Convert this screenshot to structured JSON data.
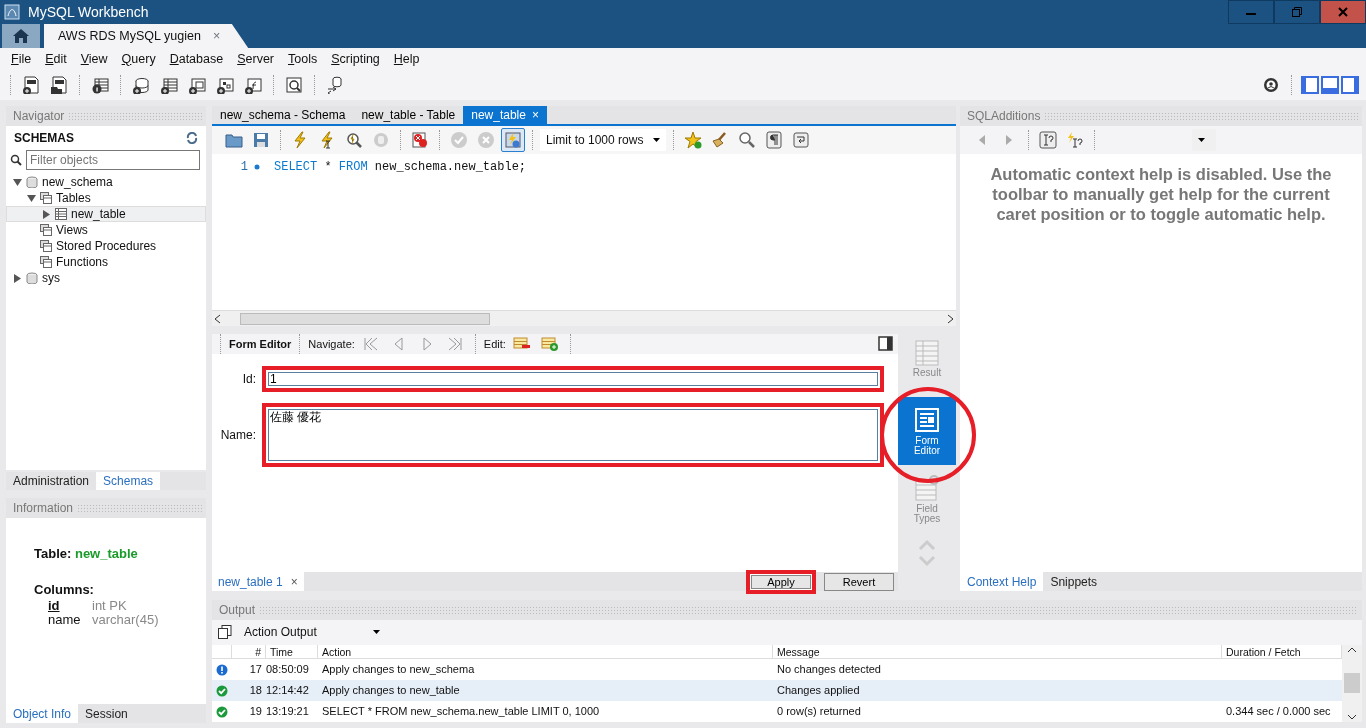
{
  "window": {
    "title": "MySQL Workbench"
  },
  "connection_tabs": [
    {
      "label": "AWS RDS MySQL yugien",
      "selected": true,
      "close": "×"
    }
  ],
  "menu": [
    "File",
    "Edit",
    "View",
    "Query",
    "Database",
    "Server",
    "Tools",
    "Scripting",
    "Help"
  ],
  "navigator": {
    "title": "Navigator",
    "section": "SCHEMAS",
    "filter": {
      "placeholder": "Filter objects"
    },
    "tree": [
      {
        "label": "new_schema",
        "kind": "schema",
        "expanded": true,
        "selected": false,
        "children": [
          {
            "label": "Tables",
            "kind": "folder",
            "expanded": true,
            "selected": false,
            "children": [
              {
                "label": "new_table",
                "kind": "table",
                "expanded": false,
                "selected": true
              }
            ]
          },
          {
            "label": "Views",
            "kind": "folder",
            "selected": false
          },
          {
            "label": "Stored Procedures",
            "kind": "folder",
            "selected": false
          },
          {
            "label": "Functions",
            "kind": "folder",
            "selected": false
          }
        ]
      },
      {
        "label": "sys",
        "kind": "schema",
        "expanded": false,
        "selected": false
      }
    ],
    "tabs": [
      {
        "label": "Administration",
        "selected": false
      },
      {
        "label": "Schemas",
        "selected": true
      }
    ]
  },
  "information": {
    "title": "Information",
    "table_label": "Table:",
    "table_name": "new_table",
    "columns_label": "Columns:",
    "columns": [
      {
        "name": "id",
        "type": "int PK",
        "primary": true
      },
      {
        "name": "name",
        "type": "varchar(45)",
        "primary": false
      }
    ],
    "tabs": [
      {
        "label": "Object Info",
        "selected": true
      },
      {
        "label": "Session",
        "selected": false
      }
    ]
  },
  "editor_tabs": [
    {
      "label": "new_schema - Schema",
      "selected": false
    },
    {
      "label": "new_table - Table",
      "selected": false
    },
    {
      "label": "new_table",
      "selected": true,
      "close": "×"
    }
  ],
  "query_toolbar": {
    "limit": "Limit to 1000 rows"
  },
  "editor_lines": [
    {
      "number": "1",
      "tokens": [
        {
          "text": "SELECT",
          "kind": "keyword"
        },
        {
          "text": " * ",
          "kind": "plain"
        },
        {
          "text": "FROM",
          "kind": "keyword"
        },
        {
          "text": " new_schema.new_table;",
          "kind": "plain"
        }
      ]
    }
  ],
  "form_editor": {
    "title": "Form Editor",
    "navigate_label": "Navigate:",
    "edit_label": "Edit:",
    "fields": [
      {
        "label": "Id:",
        "value": "1",
        "kind": "line",
        "highlighted": true
      },
      {
        "label": "Name:",
        "value": "佐藤 優花",
        "kind": "multiline",
        "highlighted": true
      }
    ]
  },
  "result_tabs": [
    {
      "label": "new_table 1",
      "selected": true,
      "close": "×"
    }
  ],
  "buttons": [
    {
      "label": "Apply",
      "highlighted": true
    },
    {
      "label": "Revert",
      "highlighted": false
    }
  ],
  "side_views": [
    {
      "label": "Result",
      "kind": "grid",
      "selected": false,
      "highlighted": false
    },
    {
      "label": "Form Editor",
      "kind": "form",
      "selected": true,
      "highlighted": true
    },
    {
      "label": "Field Types",
      "kind": "types",
      "selected": false,
      "highlighted": false
    }
  ],
  "sql_additions": {
    "title": "SQLAdditions",
    "help_text": "Automatic context help is disabled. Use the toolbar to manually get help for the current caret position or to toggle automatic help.",
    "tabs": [
      {
        "label": "Context Help",
        "selected": true
      },
      {
        "label": "Snippets",
        "selected": false
      }
    ]
  },
  "output": {
    "title": "Output",
    "selector": "Action Output",
    "columns": [
      "#",
      "Time",
      "Action",
      "Message",
      "Duration / Fetch"
    ],
    "rows": [
      {
        "kind": "info",
        "number": "17",
        "time": "08:50:09",
        "action": "Apply changes to new_schema",
        "message": "No changes detected",
        "selected": false
      },
      {
        "kind": "ok",
        "number": "18",
        "time": "12:14:42",
        "action": "Apply changes to new_table",
        "message": "Changes applied",
        "selected": true
      },
      {
        "kind": "ok",
        "number": "19",
        "time": "13:19:21",
        "action": "SELECT * FROM new_schema.new_table LIMIT 0, 1000",
        "message": "0 row(s) returned",
        "duration": "0.344 sec / 0.000 sec",
        "selected": false
      }
    ]
  }
}
